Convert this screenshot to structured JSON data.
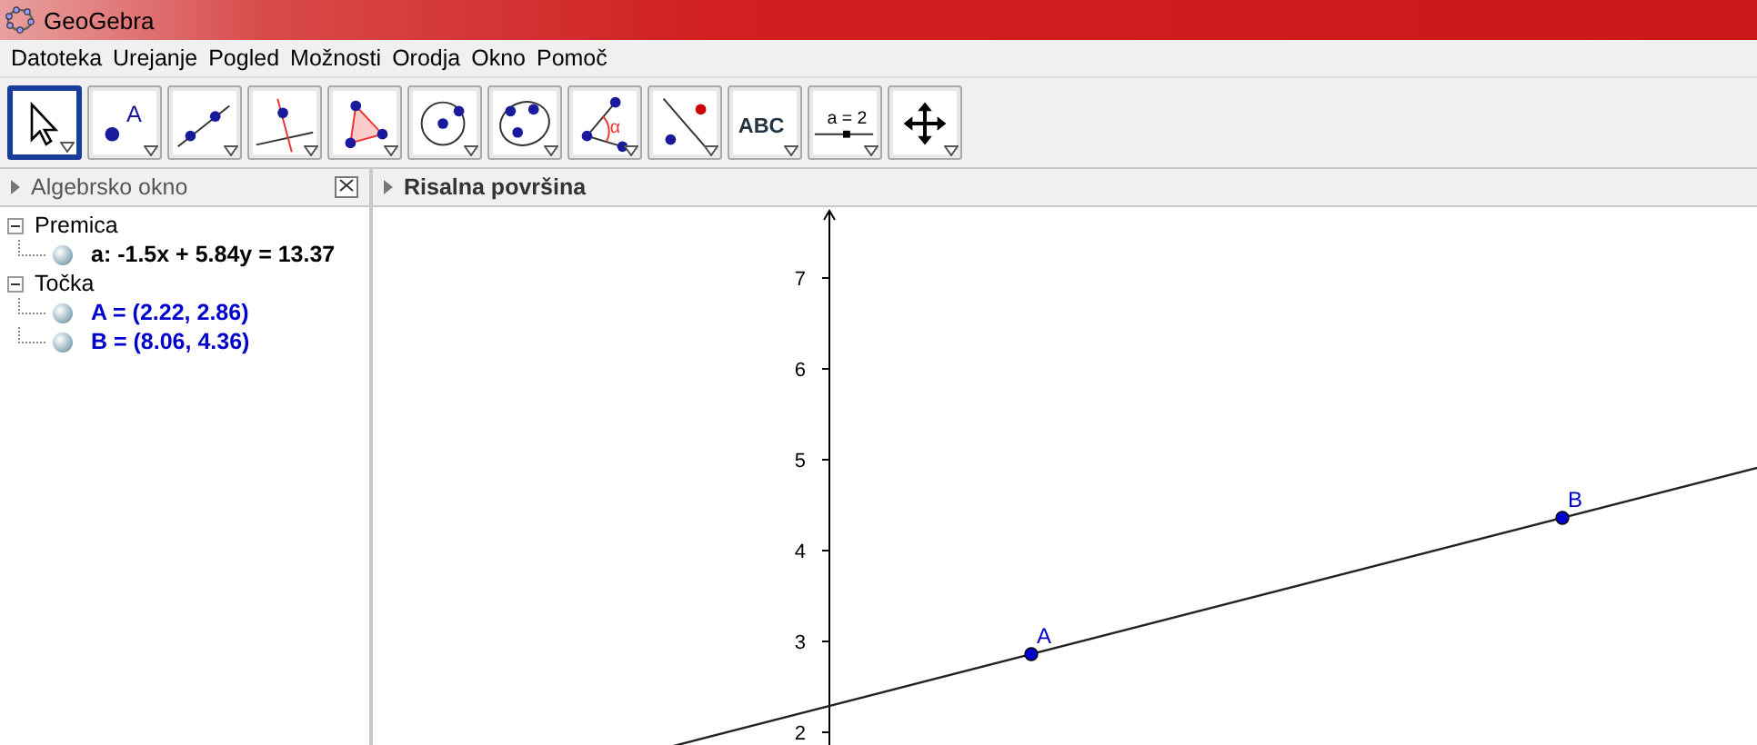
{
  "window": {
    "title": "GeoGebra"
  },
  "menu": [
    "Datoteka",
    "Urejanje",
    "Pogled",
    "Možnosti",
    "Orodja",
    "Okno",
    "Pomoč"
  ],
  "tools": [
    {
      "kind": "move",
      "selected": true
    },
    {
      "kind": "point",
      "selected": false,
      "text": "A"
    },
    {
      "kind": "line",
      "selected": false
    },
    {
      "kind": "perpendicular",
      "selected": false
    },
    {
      "kind": "polygon",
      "selected": false
    },
    {
      "kind": "circle",
      "selected": false
    },
    {
      "kind": "conic",
      "selected": false
    },
    {
      "kind": "angle",
      "selected": false,
      "text": "α"
    },
    {
      "kind": "reflect",
      "selected": false
    },
    {
      "kind": "text",
      "selected": false,
      "text": "ABC"
    },
    {
      "kind": "slider",
      "selected": false,
      "text": "a = 2"
    },
    {
      "kind": "pan",
      "selected": false
    }
  ],
  "algebra": {
    "title": "Algebrsko okno",
    "groups": [
      {
        "label": "Premica",
        "expanded": true,
        "children": [
          {
            "text": "a: -1.5x + 5.84y = 13.37",
            "color": "#000000"
          }
        ]
      },
      {
        "label": "Točka",
        "expanded": true,
        "children": [
          {
            "text": "A = (2.22, 2.86)",
            "color": "#0000cc"
          },
          {
            "text": "B = (8.06, 4.36)",
            "color": "#0000cc"
          }
        ]
      }
    ]
  },
  "graphics": {
    "title": "Risalna površina",
    "y_tick_labels": [
      "7",
      "6",
      "5",
      "4",
      "3",
      "2"
    ],
    "point_labels": [
      "A",
      "B"
    ]
  }
}
